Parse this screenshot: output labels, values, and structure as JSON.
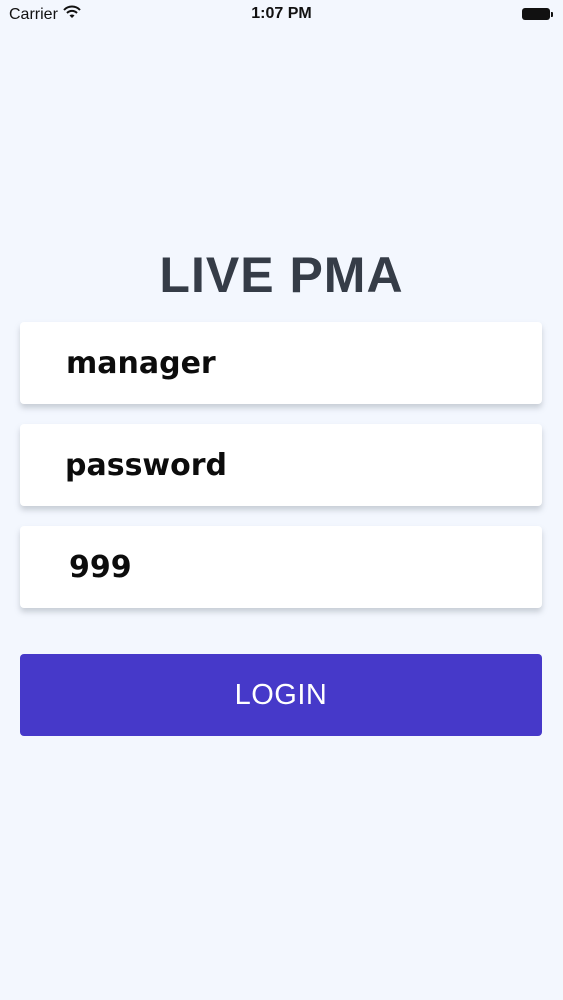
{
  "status_bar": {
    "carrier": "Carrier",
    "time": "1:07 PM",
    "wifi_icon": "wifi-icon",
    "battery_icon": "battery-icon"
  },
  "app": {
    "title": "LIVE PMA"
  },
  "form": {
    "username_value": "manager",
    "password_value": "password",
    "code_value": "999",
    "login_label": "LOGIN"
  },
  "colors": {
    "background": "#f3f7fe",
    "title": "#353c47",
    "button": "#4639c9",
    "button_text": "#ffffff",
    "field_background": "#ffffff"
  }
}
